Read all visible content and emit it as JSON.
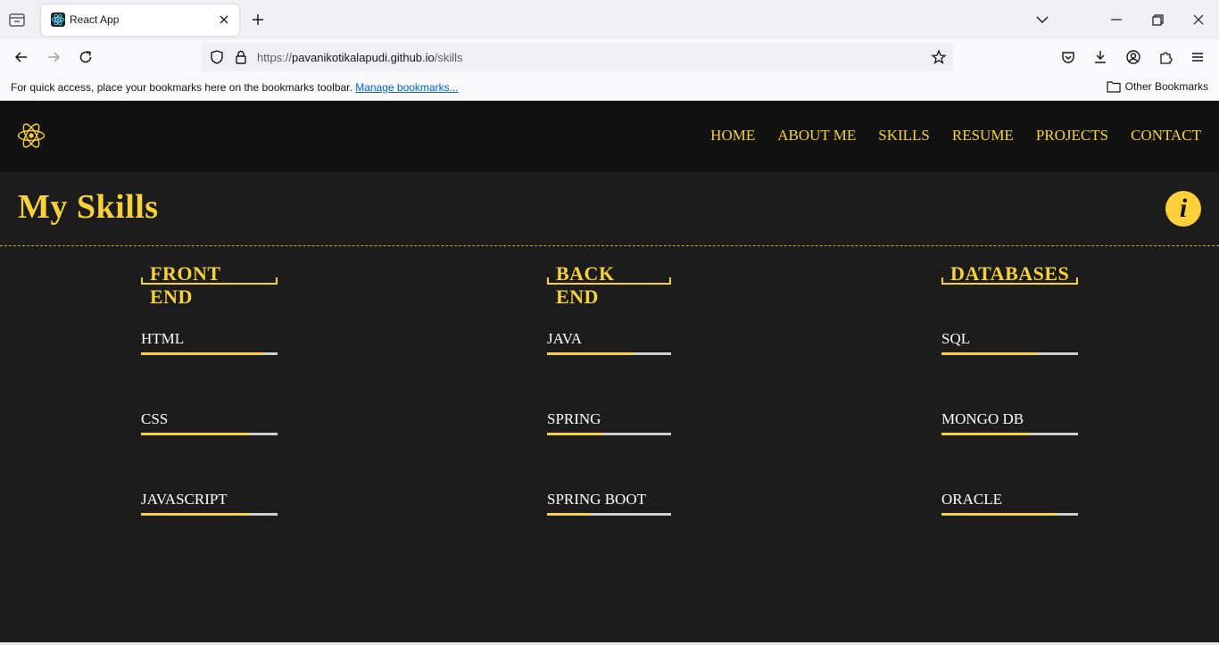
{
  "browser": {
    "tab_title": "React App",
    "url_scheme": "https://",
    "url_host": "pavanikotikalapudi.github.io",
    "url_path": "/skills",
    "bookmarks_hint": "For quick access, place your bookmarks here on the bookmarks toolbar.",
    "bookmarks_link": "Manage bookmarks...",
    "other_bookmarks": "Other Bookmarks"
  },
  "site": {
    "nav": [
      "HOME",
      "ABOUT ME",
      "SKILLS",
      "RESUME",
      "PROJECTS",
      "CONTACT"
    ],
    "page_title": "My Skills",
    "info_glyph": "i",
    "accent_color": "#f7d13a",
    "background_color": "#1c1c1c"
  },
  "skills": {
    "columns": [
      {
        "heading": "FRONT END",
        "items": [
          {
            "name": "HTML",
            "level": 0.9
          },
          {
            "name": "CSS",
            "level": 0.8
          },
          {
            "name": "JAVASCRIPT",
            "level": 0.8
          }
        ]
      },
      {
        "heading": "BACK END",
        "items": [
          {
            "name": "JAVA",
            "level": 0.7
          },
          {
            "name": "SPRING",
            "level": 0.45
          },
          {
            "name": "SPRING BOOT",
            "level": 0.35
          }
        ]
      },
      {
        "heading": "DATABASES",
        "items": [
          {
            "name": "SQL",
            "level": 0.7
          },
          {
            "name": "MONGO DB",
            "level": 0.65
          },
          {
            "name": "ORACLE",
            "level": 0.85
          }
        ]
      }
    ]
  }
}
